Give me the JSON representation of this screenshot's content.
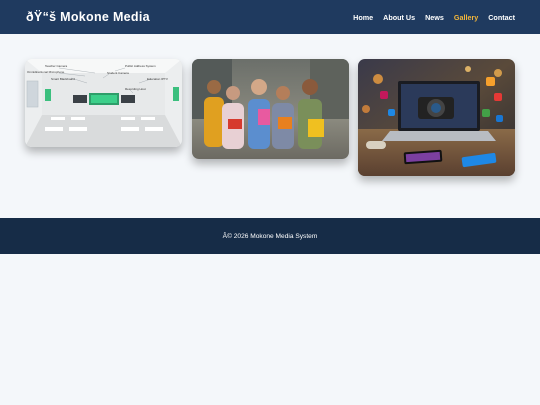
{
  "header": {
    "brand": "ðŸ“š Mokone Media",
    "nav": [
      {
        "label": "Home"
      },
      {
        "label": "About Us"
      },
      {
        "label": "News"
      },
      {
        "label": "Gallery"
      },
      {
        "label": "Contact"
      }
    ],
    "active_color": "#f3b63a",
    "background": "#1f3a5f"
  },
  "gallery": {
    "classroom_labels": [
      "Teacher Camera",
      "Public Address System",
      "Omnidirectional Microphone",
      "Student Camera",
      "Smart Blackboard",
      "Education IPTV",
      "Recording Host"
    ]
  },
  "footer": {
    "text": "Â© 2026 Mokone Media System",
    "background": "#162c47"
  }
}
